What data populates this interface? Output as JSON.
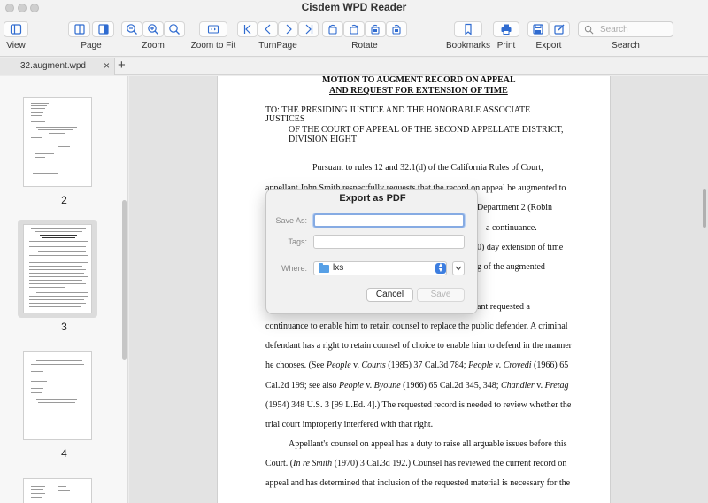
{
  "window": {
    "title": "Cisdem WPD Reader"
  },
  "toolbar": {
    "labels": {
      "view": "View",
      "page": "Page",
      "zoom": "Zoom",
      "zoom_to_fit": "Zoom to Fit",
      "turnpage": "TurnPage",
      "rotate": "Rotate",
      "bookmarks": "Bookmarks",
      "print": "Print",
      "export": "Export",
      "search": "Search"
    },
    "search_placeholder": "Search"
  },
  "tabs": {
    "active": "32.augment.wpd",
    "close": "×",
    "add": "+"
  },
  "sidebar": {
    "pages": [
      "2",
      "3",
      "4"
    ]
  },
  "document": {
    "title1": "MOTION TO AUGMENT RECORD ON APPEAL",
    "title2": "AND REQUEST FOR EXTENSION OF TIME",
    "to_1": "TO:     THE PRESIDING JUSTICE AND THE HONORABLE ASSOCIATE",
    "to_2": "JUSTICES",
    "to_3": "OF THE COURT OF APPEAL OF THE SECOND APPELLATE DISTRICT,",
    "to_4": "DIVISION EIGHT",
    "p1": "Pursuant to rules 12 and 32.1(d) of the California Rules of Court,",
    "p2": "appellant John Smith respectfully requests that the record on appeal be augmented to",
    "p3_tail": "Department  2 (Robin",
    "p4_tail": "a continuance.",
    "p5_tail": "0) day extension of time",
    "p6_tail": "g of the augmented",
    "p7_tail": "ant requested a",
    "l1": "continuance to enable him to retain counsel to replace the public defender. A criminal",
    "l2": "defendant has a right to retain counsel of choice to enable him to defend in the manner",
    "l3_a": "he chooses. (See ",
    "l3_b": "People",
    "l3_c": " v. ",
    "l3_d": "Courts",
    "l3_e": " (1985) 37 Cal.3d 784; ",
    "l3_f": "People",
    "l3_g": " v. ",
    "l3_h": "Crovedi",
    "l3_i": " (1966) 65",
    "l4_a": "Cal.2d 199; see also ",
    "l4_b": "People",
    "l4_c": " v. ",
    "l4_d": "Byoune",
    "l4_e": " (1966) 65 Cal.2d 345, 348; ",
    "l4_f": "Chandler",
    "l4_g": " v. ",
    "l4_h": "Fretag",
    "l5": "(1954) 348 U.S. 3 [99 L.Ed. 4].)  The requested record is needed to review whether the",
    "l6": "trial court improperly interfered with that right.",
    "l7": "Appellant's counsel on appeal has a duty to raise all arguable issues before this",
    "l8_a": "Court. (",
    "l8_b": "In re Smith",
    "l8_c": " (1970) 3 Cal.3d 192.)  Counsel has reviewed the current record on",
    "l9": "appeal and has determined that inclusion of the requested material is necessary for the"
  },
  "dialog": {
    "title": "Export as PDF",
    "save_as_label": "Save As:",
    "save_as_value": "",
    "tags_label": "Tags:",
    "where_label": "Where:",
    "where_value": "lxs",
    "cancel": "Cancel",
    "save": "Save"
  },
  "colors": {
    "accent": "#3d7ee0",
    "focus": "#86abe3",
    "folder": "#57a0e6"
  }
}
